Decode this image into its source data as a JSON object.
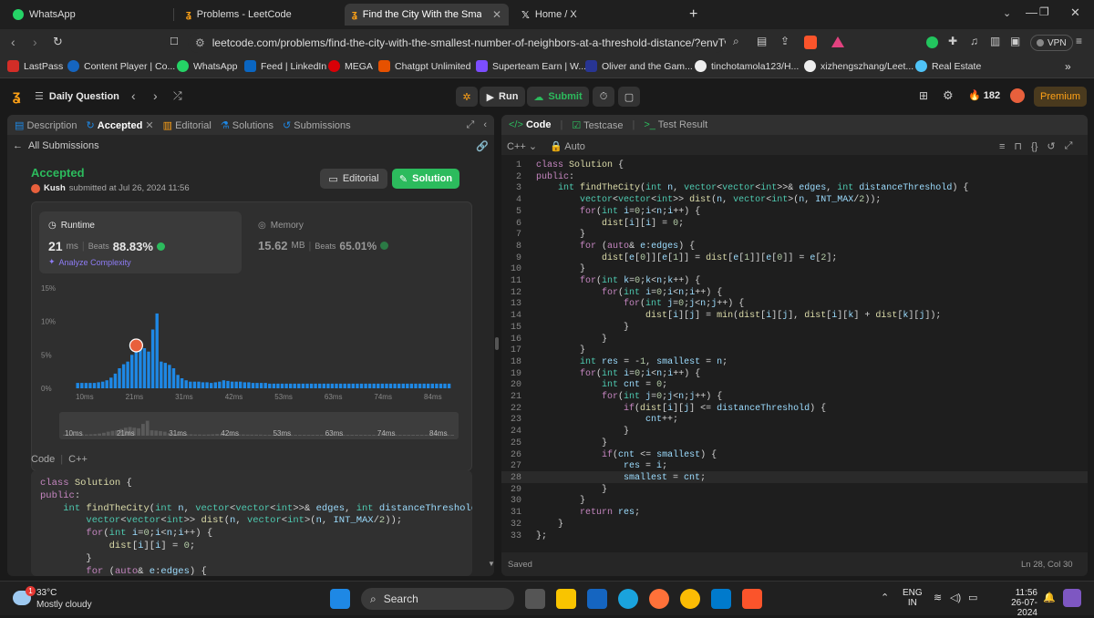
{
  "browser": {
    "tabs": [
      {
        "title": "WhatsApp"
      },
      {
        "title": "Problems - LeetCode"
      },
      {
        "title": "Find the City With the Smallest"
      },
      {
        "title": "Home / X"
      }
    ],
    "url": "leetcode.com/problems/find-the-city-with-the-smallest-number-of-neighbors-at-a-threshold-distance/?envType...",
    "vpn": "VPN"
  },
  "bookmarks": [
    "LastPass",
    "Content Player | Co...",
    "WhatsApp",
    "Feed | LinkedIn",
    "MEGA",
    "Chatgpt Unlimited",
    "Superteam Earn | W...",
    "Oliver and the Gam...",
    "tinchotamola123/H...",
    "xizhengszhang/Leet...",
    "Real Estate"
  ],
  "lcnav": {
    "daily": "Daily Question",
    "run": "Run",
    "submit": "Submit",
    "streak": "182",
    "premium": "Premium"
  },
  "left": {
    "tabs": [
      "Description",
      "Accepted",
      "Editorial",
      "Solutions",
      "Submissions"
    ],
    "back": "All Submissions",
    "status": "Accepted",
    "user": "Kush",
    "submitted": "submitted at Jul 26, 2024 11:56",
    "editorial_btn": "Editorial",
    "solution_btn": "Solution",
    "runtime_label": "Runtime",
    "runtime_val": "21",
    "runtime_unit": "ms",
    "beats_label": "Beats",
    "runtime_beats": "88.83%",
    "analyze": "Analyze Complexity",
    "memory_label": "Memory",
    "memory_val": "15.62",
    "memory_unit": "MB",
    "memory_beats": "65.01%",
    "code_label": "Code",
    "lang": "C++"
  },
  "chart_data": {
    "type": "bar",
    "yticks": [
      "15%",
      "10%",
      "5%",
      "0%"
    ],
    "xticks": [
      "10ms",
      "21ms",
      "31ms",
      "42ms",
      "53ms",
      "63ms",
      "74ms",
      "84ms"
    ],
    "ylim": [
      0,
      15
    ],
    "values": [
      0.8,
      0.8,
      0.8,
      0.8,
      0.8,
      0.9,
      1.0,
      1.2,
      1.6,
      2.2,
      3.0,
      3.6,
      4.0,
      5.0,
      6.0,
      6.5,
      6.0,
      5.5,
      8.8,
      11.2,
      4.0,
      3.8,
      3.5,
      3.0,
      2.0,
      1.5,
      1.2,
      1.0,
      1.0,
      1.0,
      0.9,
      0.9,
      0.8,
      0.9,
      1.0,
      1.2,
      1.1,
      1.0,
      1.0,
      1.0,
      0.9,
      0.9,
      0.8,
      0.8,
      0.8,
      0.8,
      0.7,
      0.7,
      0.7,
      0.7,
      0.7,
      0.7,
      0.7,
      0.7,
      0.7,
      0.7,
      0.7,
      0.7,
      0.7,
      0.7,
      0.7,
      0.7,
      0.7,
      0.7,
      0.7,
      0.7,
      0.7,
      0.7,
      0.7,
      0.7,
      0.7,
      0.7,
      0.7,
      0.7,
      0.7,
      0.7,
      0.7,
      0.7,
      0.7,
      0.7,
      0.7,
      0.7,
      0.7,
      0.7,
      0.7,
      0.7,
      0.7,
      0.7,
      0.7,
      0.7
    ],
    "highlight_index": 14,
    "bar_color": "#1e88e5",
    "highlight_color": "#ffffff"
  },
  "right": {
    "tabs": [
      "Code",
      "Testcase",
      "Test Result"
    ],
    "lang": "C++",
    "mode": "Auto",
    "saved": "Saved",
    "cursor": "Ln 28, Col 30"
  },
  "code_lines": [
    "class Solution {",
    "public:",
    "    int findTheCity(int n, vector<vector<int>>& edges, int distanceThreshold) {",
    "        vector<vector<int>> dist(n, vector<int>(n, INT_MAX/2));",
    "        for(int i=0;i<n;i++) {",
    "            dist[i][i] = 0;",
    "        }",
    "        for (auto& e:edges) {",
    "            dist[e[0]][e[1]] = dist[e[1]][e[0]] = e[2];",
    "        }",
    "        for(int k=0;k<n;k++) {",
    "            for(int i=0;i<n;i++) {",
    "                for(int j=0;j<n;j++) {",
    "                    dist[i][j] = min(dist[i][j], dist[i][k] + dist[k][j]);",
    "                }",
    "            }",
    "        }",
    "        int res = -1, smallest = n;",
    "        for(int i=0;i<n;i++) {",
    "            int cnt = 0;",
    "            for(int j=0;j<n;j++) {",
    "                if(dist[i][j] <= distanceThreshold) {",
    "                    cnt++;",
    "                }",
    "            }",
    "            if(cnt <= smallest) {",
    "                res = i;",
    "                smallest = cnt;",
    "            }",
    "        }",
    "        return res;",
    "    }",
    "};"
  ],
  "preview_lines": [
    "class Solution {",
    "public:",
    "    int findTheCity(int n, vector<vector<int>>& edges, int distanceThreshold) {",
    "        vector<vector<int>> dist(n, vector<int>(n, INT_MAX/2));",
    "        for(int i=0;i<n;i++) {",
    "            dist[i][i] = 0;",
    "        }",
    "        for (auto& e:edges) {"
  ],
  "taskbar": {
    "temp": "33°C",
    "weather": "Mostly cloudy",
    "badge": "1",
    "search": "Search",
    "lang1": "ENG",
    "lang2": "IN",
    "time": "11:56",
    "date": "26-07-2024"
  }
}
